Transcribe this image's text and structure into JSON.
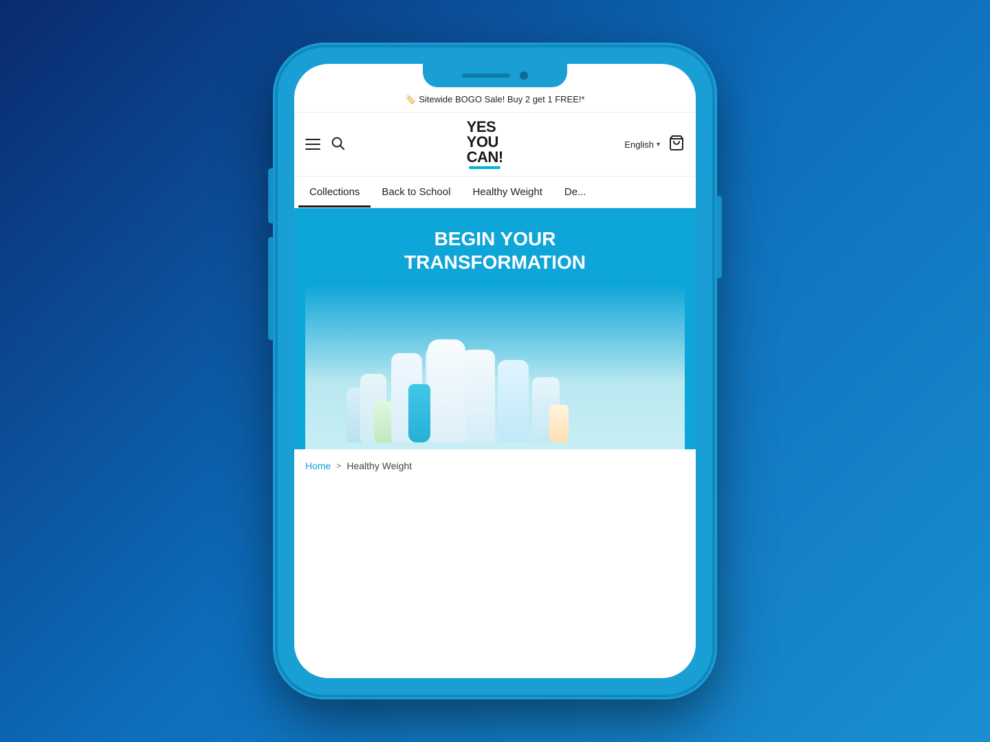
{
  "phone": {
    "notch": {
      "speaker_label": "speaker",
      "camera_label": "camera"
    }
  },
  "promo_banner": {
    "emoji": "🏷️",
    "text": "Sitewide BOGO Sale! Buy 2 get 1 FREE!*"
  },
  "header": {
    "logo_line1": "YES",
    "logo_line2": "YOU",
    "logo_line3": "CAN!",
    "language": "English",
    "cart_label": "Cart"
  },
  "nav": {
    "items": [
      {
        "label": "Collections",
        "active": true
      },
      {
        "label": "Back to School",
        "active": false
      },
      {
        "label": "Healthy Weight",
        "active": false
      },
      {
        "label": "De...",
        "active": false
      }
    ]
  },
  "hero": {
    "title_line1": "BEGIN YOUR",
    "title_line2": "TRANSFORMATION"
  },
  "breadcrumb": {
    "home_label": "Home",
    "separator": ">",
    "current": "Healthy Weight"
  },
  "icons": {
    "hamburger": "☰",
    "search": "🔍",
    "cart": "🛒",
    "chevron_down": "▾"
  }
}
